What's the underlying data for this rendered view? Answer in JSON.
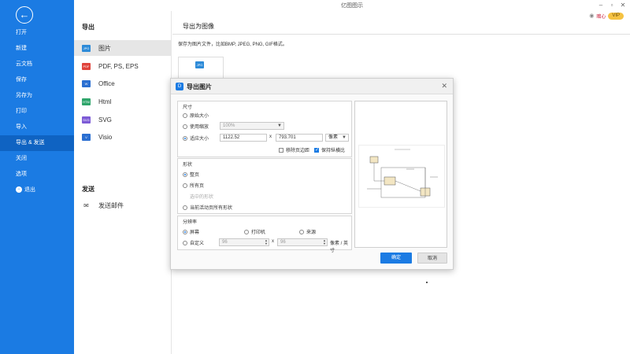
{
  "window": {
    "title": "亿图图示",
    "minimize": "–",
    "restore": "▫",
    "close": "✕",
    "user": "暗心",
    "vip": "VIP"
  },
  "sidebar": {
    "back_glyph": "←",
    "items": [
      "打开",
      "新建",
      "云文档",
      "保存",
      "另存为",
      "打印",
      "导入",
      "导出 & 发送",
      "关闭",
      "选项"
    ],
    "logout": "退出",
    "active_index": 7
  },
  "export_panel": {
    "heading": "导出",
    "formats": [
      {
        "label": "图片",
        "tag": "JPG",
        "color": "#2e8bd8"
      },
      {
        "label": "PDF, PS, EPS",
        "tag": "PDF",
        "color": "#e0433b"
      },
      {
        "label": "Office",
        "tag": "W",
        "color": "#2b6fd1"
      },
      {
        "label": "Html",
        "tag": "HTM",
        "color": "#2fa56b"
      },
      {
        "label": "SVG",
        "tag": "SVG",
        "color": "#7d5bd6"
      },
      {
        "label": "Visio",
        "tag": "V",
        "color": "#2b6fd1"
      }
    ],
    "send_heading": "发送",
    "send_email": "发送邮件"
  },
  "main": {
    "title": "导出为图像",
    "description": "保存为图片文件，比如BMP, JPEG, PNG, GIF格式。",
    "card_tag": "JPG"
  },
  "dialog": {
    "title": "导出图片",
    "size_group": {
      "label": "尺寸",
      "original": "原始大小",
      "use_zoom": "使用缩放",
      "zoom_value": "100%",
      "fit_size": "适应大小",
      "width": "1122.52",
      "x": "x",
      "height": "793.701",
      "unit": "像素",
      "remove_margin": "移除页边距",
      "keep_ratio": "保持纵横比"
    },
    "shape_group": {
      "label": "形状",
      "current_page": "整页",
      "all_pages": "所有页",
      "selected": "选中的形状",
      "all_active": "当前活动页所有形状"
    },
    "resolution_group": {
      "label": "分辨率",
      "screen": "屏幕",
      "printer": "打印机",
      "source": "来源",
      "custom": "自定义",
      "dpi_x": "96",
      "x": "x",
      "dpi_y": "96",
      "unit": "像素 / 英寸"
    },
    "ok": "确定",
    "cancel": "取消"
  }
}
